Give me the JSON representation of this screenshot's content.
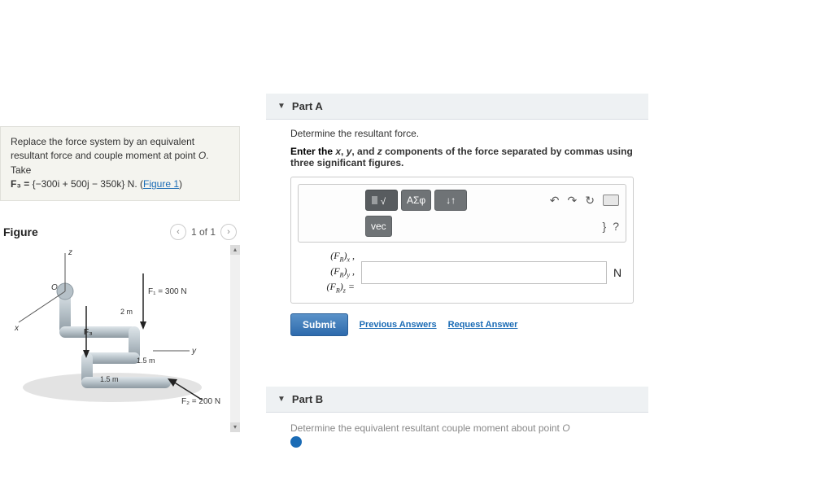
{
  "problem": {
    "text1": "Replace the force system by an equivalent resultant force and couple moment at point ",
    "pointO": "O",
    "text2": ". Take",
    "force_eq_lhs": "F₃ = ",
    "force_eq_vec": "{−300i + 500j − 350k}",
    "force_eq_unit": " N. (",
    "figure_link": "Figure 1",
    "close": ")"
  },
  "figure": {
    "title": "Figure",
    "count": "1 of 1",
    "labels": {
      "z": "z",
      "x": "x",
      "y": "y",
      "O": "O",
      "F1": "F₁ = 300 N",
      "F2": "F₂ = 200 N",
      "F3": "F₃",
      "d2m": "2 m",
      "d15a": "1.5 m",
      "d15b": "1.5 m"
    }
  },
  "partA": {
    "header": "Part A",
    "prompt": "Determine the resultant force.",
    "hint_pre": "Enter the ",
    "hint_x": "x",
    "hint_sep1": ", ",
    "hint_y": "y",
    "hint_sep2": ", and ",
    "hint_z": "z",
    "hint_post": " components of the force separated by commas using three significant figures.",
    "tool_sigma": "ΑΣφ",
    "tool_arrows": "↓↑",
    "tool_vec": "vec",
    "tool_undo": "↶",
    "tool_redo": "↷",
    "tool_reset": "↻",
    "help_brace": "}",
    "help_q": "?",
    "fr_labels": "(F_R)_x ,\n(F_R)_y ,\n(F_R)_z =",
    "unit": "N",
    "submit": "Submit",
    "prev": "Previous Answers",
    "req": "Request Answer"
  },
  "partB": {
    "header": "Part B",
    "prompt_partial": "Determine the equivalent resultant couple moment about point ",
    "pointO": "O"
  }
}
